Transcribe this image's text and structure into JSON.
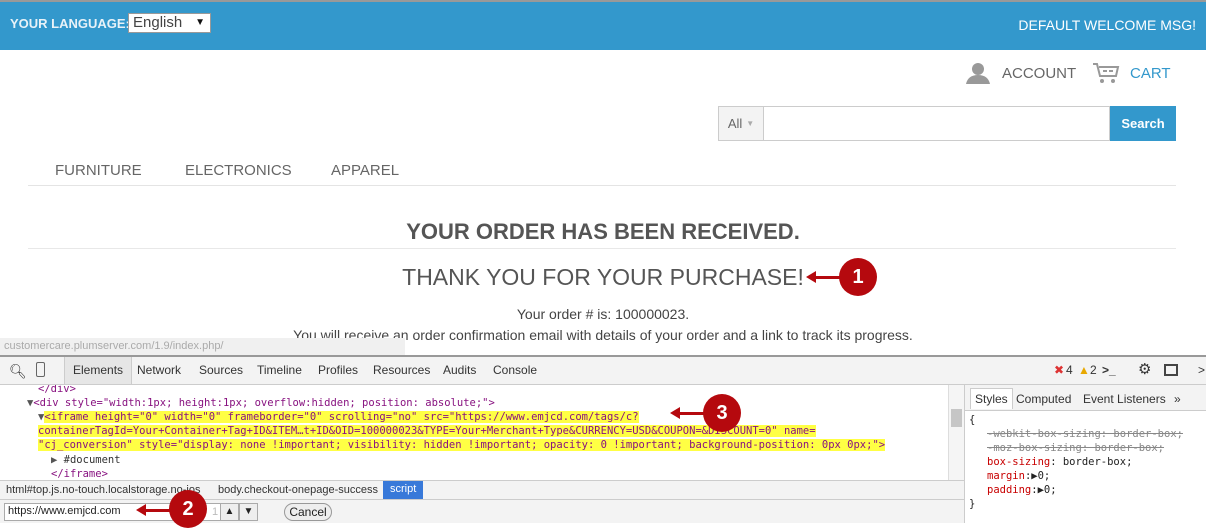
{
  "header": {
    "language_label": "YOUR LANGUAGE:",
    "language_value": "English",
    "welcome": "DEFAULT WELCOME MSG!",
    "brand_color": "#3398cc"
  },
  "account": {
    "label": "ACCOUNT",
    "icon": "user-icon"
  },
  "cart": {
    "label": "CART",
    "icon": "cart-icon"
  },
  "search": {
    "category": "All",
    "value": "",
    "button": "Search"
  },
  "nav": [
    "FURNITURE",
    "ELECTRONICS",
    "APPAREL"
  ],
  "main": {
    "title": "YOUR ORDER HAS BEEN RECEIVED.",
    "subtitle": "THANK YOU FOR YOUR PURCHASE!",
    "order_number_text": "Your order # is: 100000023.",
    "confirmation_text": "You will receive an order confirmation email with details of your order and a link to track its progress."
  },
  "status_bar": "customercare.plumserver.com/1.9/index.php/",
  "devtools": {
    "tabs": [
      "Elements",
      "Network",
      "Sources",
      "Timeline",
      "Profiles",
      "Resources",
      "Audits",
      "Console"
    ],
    "errors": "4",
    "warnings": "2",
    "code_lines": [
      "</div>",
      "<div style=\"width:1px; height:1px; overflow:hidden; position: absolute;\">",
      "<iframe height=\"0\" width=\"0\" frameborder=\"0\" scrolling=\"no\" src=\"https://www.emjcd.com/tags/c?",
      "containerTagId=Your+Container+Tag+ID&ITEM…t+ID&OID=100000023&TYPE=Your+Merchant+Type&CURRENCY=USD&COUPON=&DISCOUNT=0\" name=",
      "\"cj_conversion\" style=\"display: none !important; visibility: hidden !important; opacity: 0 !important; background-position: 0px 0px;\">",
      "#document",
      "</iframe>"
    ],
    "breadcrumbs": [
      "html#top.js.no-touch.localstorage.no-ios",
      "body.checkout-onepage-success",
      "script"
    ],
    "find_value": "https://www.emjcd.com",
    "find_count": "1",
    "cancel": "Cancel",
    "side_tabs": [
      "Styles",
      "Computed",
      "Event Listeners",
      "»"
    ],
    "styles": {
      "open": "{",
      "webkit": "-webkit-box-sizing: border-box;",
      "moz": "-moz-box-sizing: border-box;",
      "box_sizing_prop": "box-sizing",
      "box_sizing_val": ": border-box;",
      "margin_prop": "margin",
      "margin_val": ":▶0;",
      "padding_prop": "padding",
      "padding_val": ":▶0;",
      "close": "}"
    }
  },
  "callouts": [
    "1",
    "2",
    "3"
  ],
  "callout_color": "#b5090e"
}
